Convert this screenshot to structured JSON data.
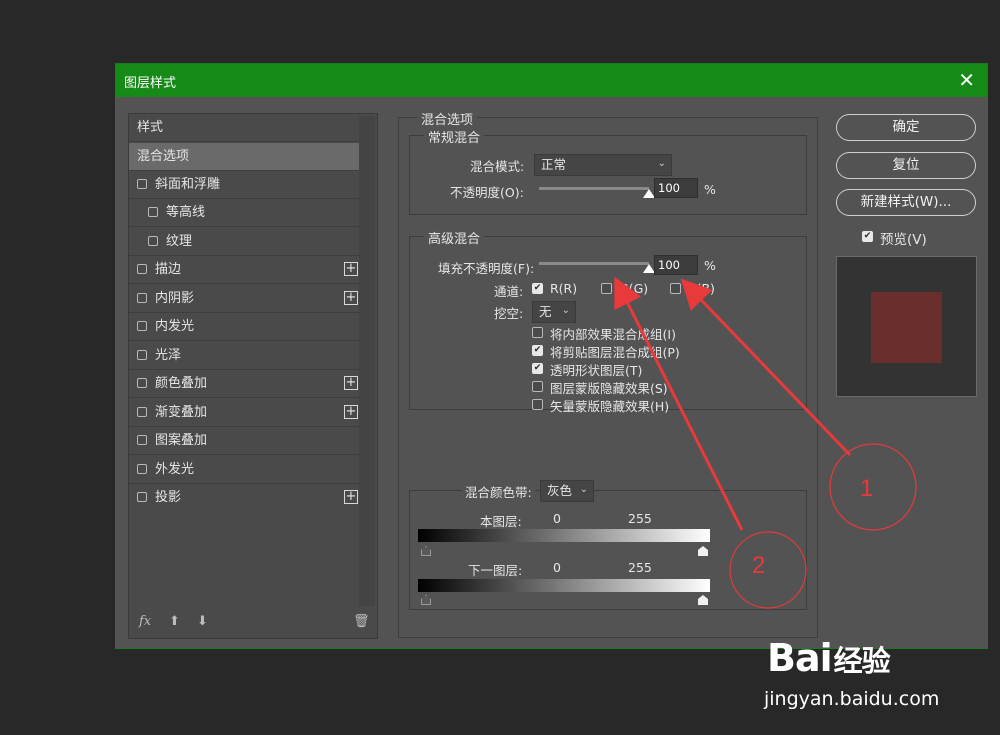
{
  "dialog": {
    "title": "图层样式",
    "close": "✕"
  },
  "style_list": {
    "header": "样式",
    "items": [
      {
        "label": "混合选项",
        "selected": true
      },
      {
        "label": "斜面和浮雕",
        "checkbox": true
      },
      {
        "label": "等高线",
        "checkbox": true,
        "indent": true
      },
      {
        "label": "纹理",
        "checkbox": true,
        "indent": true
      },
      {
        "label": "描边",
        "checkbox": true,
        "plus": true
      },
      {
        "label": "内阴影",
        "checkbox": true,
        "plus": true
      },
      {
        "label": "内发光",
        "checkbox": true
      },
      {
        "label": "光泽",
        "checkbox": true
      },
      {
        "label": "颜色叠加",
        "checkbox": true,
        "plus": true
      },
      {
        "label": "渐变叠加",
        "checkbox": true,
        "plus": true
      },
      {
        "label": "图案叠加",
        "checkbox": true
      },
      {
        "label": "外发光",
        "checkbox": true
      },
      {
        "label": "投影",
        "checkbox": true,
        "plus": true
      }
    ],
    "plus_symbol": "+",
    "footer": {
      "fx": "fx",
      "up": "⬆",
      "down": "⬇",
      "trash": "🗑"
    }
  },
  "blend": {
    "section_title": "混合选项",
    "general": {
      "title": "常规混合",
      "mode_label": "混合模式:",
      "mode_value": "正常",
      "opacity_label": "不透明度(O):",
      "opacity_value": "100",
      "opacity_fraction": 1.0,
      "percent": "%"
    },
    "advanced": {
      "title": "高级混合",
      "fill_label": "填充不透明度(F):",
      "fill_value": "100",
      "fill_fraction": 1.0,
      "percent": "%",
      "channels_label": "通道:",
      "channel_r": "R(R)",
      "channel_g": "G(G)",
      "channel_b": "B(B)",
      "knockout_label": "挖空:",
      "knockout_value": "无",
      "options": [
        {
          "label": "将内部效果混合成组(I)",
          "checked": false
        },
        {
          "label": "将剪贴图层混合成组(P)",
          "checked": true
        },
        {
          "label": "透明形状图层(T)",
          "checked": true
        },
        {
          "label": "图层蒙版隐藏效果(S)",
          "checked": false
        },
        {
          "label": "矢量蒙版隐藏效果(H)",
          "checked": false
        }
      ]
    },
    "blend_if": {
      "label": "混合颜色带:",
      "value": "灰色",
      "this_layer_label": "本图层:",
      "this_layer_min": "0",
      "this_layer_max": "255",
      "under_layer_label": "下一图层:",
      "under_layer_min": "0",
      "under_layer_max": "255"
    }
  },
  "buttons": {
    "ok": "确定",
    "reset": "复位",
    "new_style": "新建样式(W)...",
    "preview_label": "预览(V)",
    "preview_checked": true
  },
  "colors": {
    "titlebar": "#168a16",
    "preview_swatch": "#6a2f2d",
    "annotation": "#e83a3a"
  },
  "annotations": {
    "label_1": "1",
    "label_2": "2"
  },
  "watermark": {
    "brand": "Bai",
    "brand_cn": "经验",
    "url": "jingyan.baidu.com"
  }
}
